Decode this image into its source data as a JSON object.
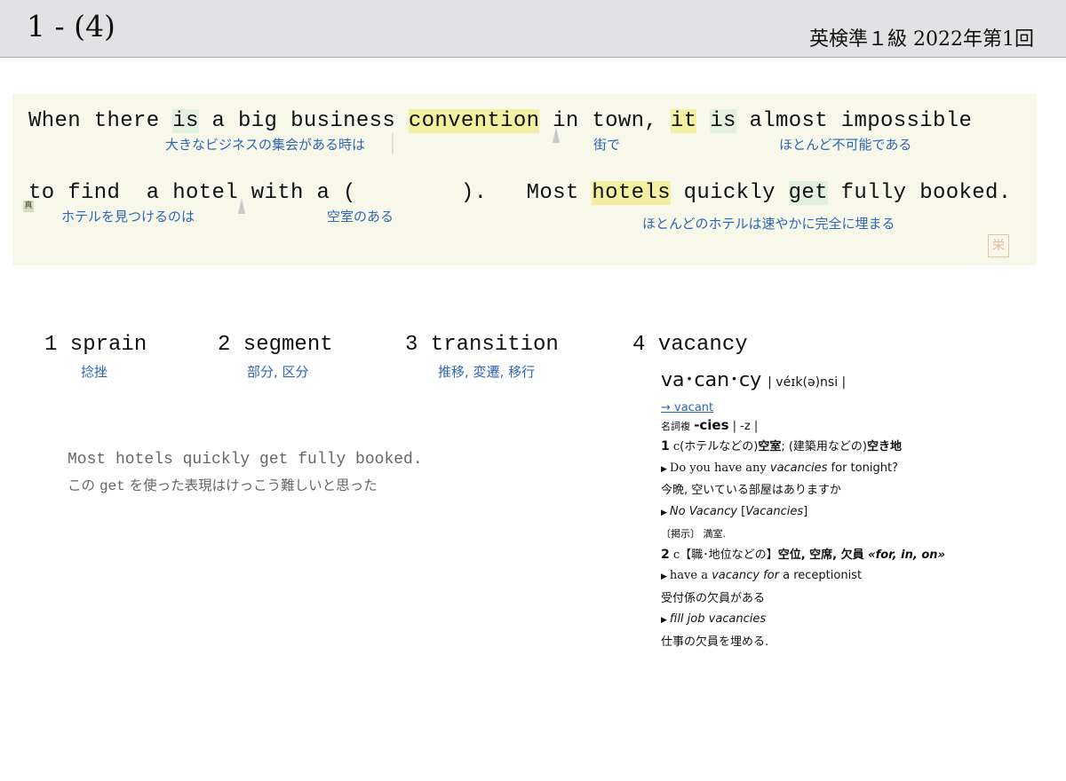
{
  "header": {
    "slide_title": "1 - (4)",
    "exam_label": "英検準１級  2022年第1回"
  },
  "sentence": {
    "line1": {
      "w1": "When there ",
      "w2": "is",
      "w3": " a big business ",
      "w4": "convention",
      "w5": " in town, ",
      "w6": "it",
      "w7": " ",
      "w8": "is",
      "w9": " almost impossible"
    },
    "line1_ja": {
      "a": "大きなビジネスの集会がある時は",
      "b": "街で",
      "c": "ほとんど不可能である"
    },
    "line2": {
      "w1": "to find  a hotel with a (        ).   Most ",
      "w2": "hotels",
      "w3": " quickly ",
      "w4": "get",
      "w5": " fully booked."
    },
    "line2_ja": {
      "a": "ホテルを見つけるのは",
      "b": "空室のある",
      "c": "ほとんどのホテルは速やかに完全に埋まる"
    },
    "marker_shin": "真",
    "stamp": "栄"
  },
  "choices": [
    {
      "num_word": "1 sprain",
      "ja": "捻挫"
    },
    {
      "num_word": "2 segment",
      "ja": "部分, 区分"
    },
    {
      "num_word": "3 transition",
      "ja": "推移, 変遷, 移行"
    },
    {
      "num_word": "4 vacancy",
      "ja": ""
    }
  ],
  "note": {
    "en": "Most hotels quickly get fully booked.",
    "ja_prefix": "この ",
    "ja_code": "get",
    "ja_suffix": " を使った表現はけっこう難しいと思った"
  },
  "dictionary": {
    "headword": "va･can･cy",
    "pronunciation": "| véɪk(ə)nsi |",
    "link": "→ vacant",
    "pos_label": "名詞複",
    "plural": "-cies",
    "plural_alt": "| -z |",
    "sense1_num": "1",
    "sense1_c": "c",
    "sense1_text_a": "(ホテルなどの)",
    "sense1_bold_a": "空室",
    "sense1_text_b": "; (建築用などの)",
    "sense1_bold_b": "空き地",
    "ex1_en_a": "Do you have any ",
    "ex1_en_b": "vacancies",
    "ex1_en_c": " for tonight?",
    "ex1_ja": "今晩, 空いている部屋はありますか",
    "ex2_en_a": "No Vacancy",
    "ex2_en_b": " [",
    "ex2_en_c": "Vacancies",
    "ex2_en_d": "]",
    "ex2_ja": "〔掲示〕 満室.",
    "sense2_num": "2",
    "sense2_c": "c",
    "sense2_label": "【職･地位などの】",
    "sense2_bold": "空位, 空席, 欠員",
    "sense2_prep": " «for, in, on»",
    "ex3_en_a": "have a ",
    "ex3_en_b": "vacancy for",
    "ex3_en_c": " a receptionist",
    "ex3_ja": "受付係の欠員がある",
    "ex4_en": "fill job vacancies",
    "ex4_ja": "仕事の欠員を埋める."
  }
}
